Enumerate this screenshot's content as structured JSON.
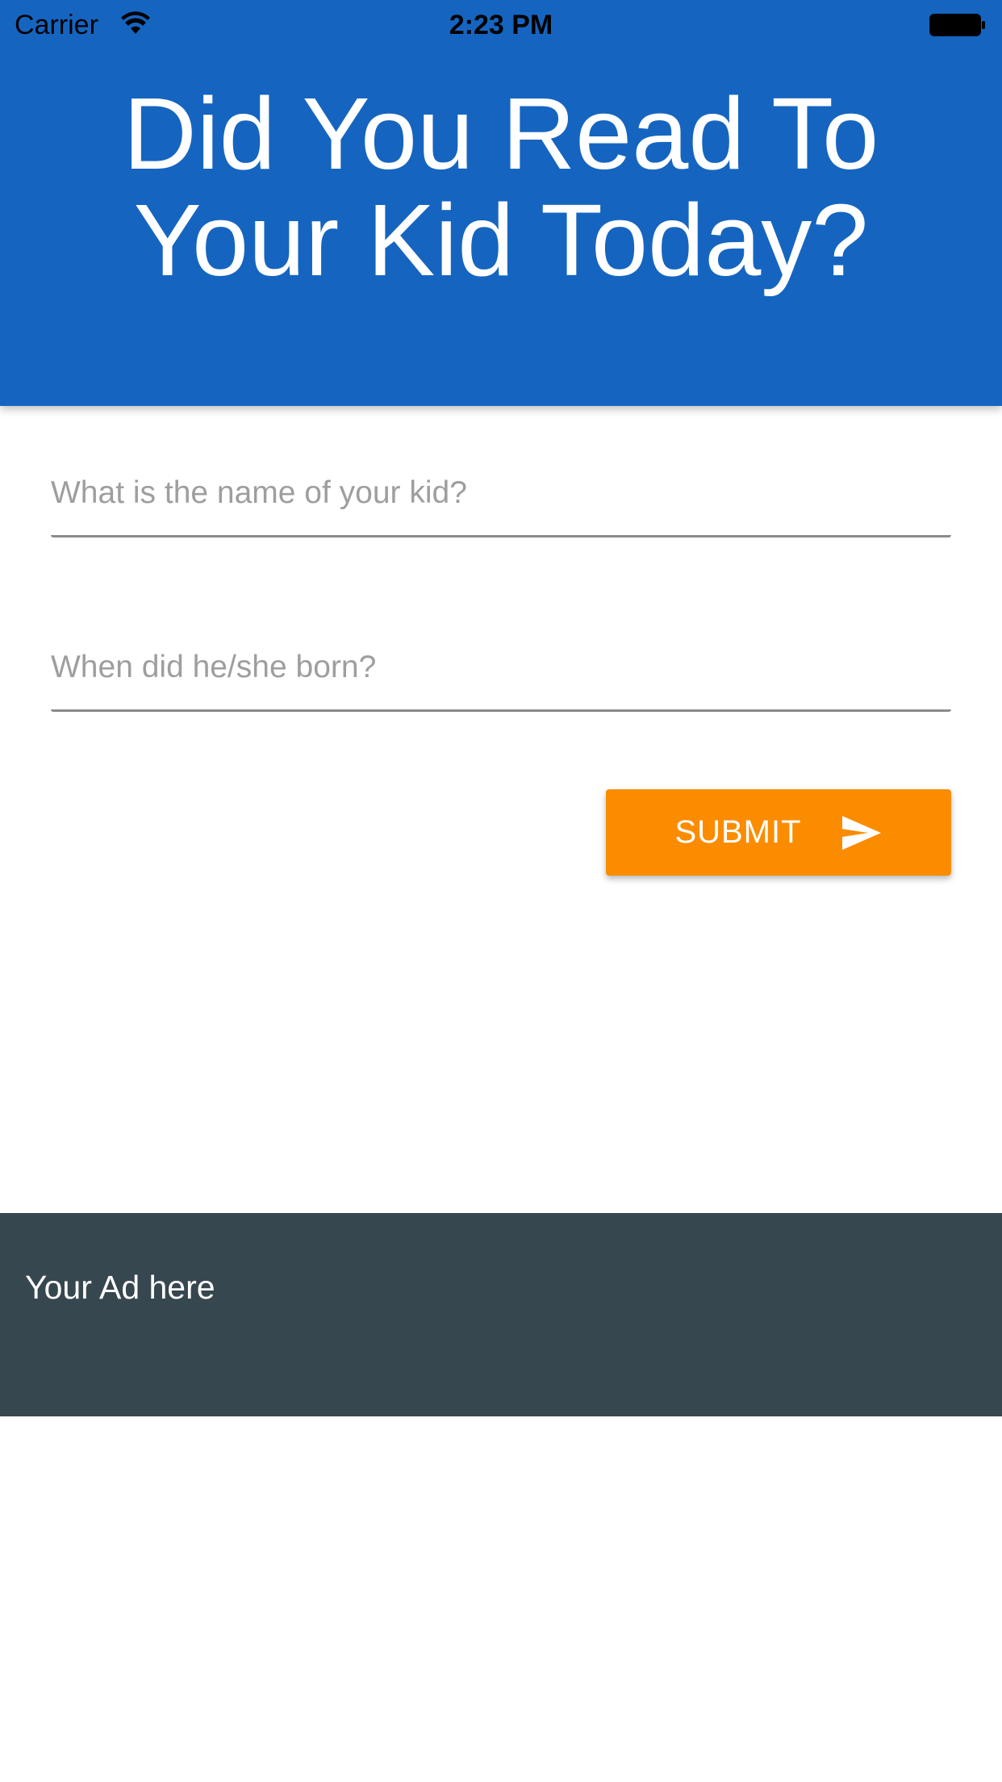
{
  "status_bar": {
    "carrier": "Carrier",
    "time": "2:23 PM",
    "wifi_icon": "wifi-icon",
    "battery_icon": "battery-icon"
  },
  "header": {
    "title": "Did You Read To Your Kid Today?",
    "background_color": "#1565c0"
  },
  "form": {
    "name_field": {
      "placeholder": "What is the name of your kid?",
      "value": ""
    },
    "birth_field": {
      "placeholder": "When did he/she born?",
      "value": ""
    },
    "submit": {
      "label": "SUBMIT",
      "icon": "send-icon",
      "color": "#fb8c00"
    }
  },
  "ad": {
    "text": "Your Ad here",
    "background_color": "#37474f"
  }
}
